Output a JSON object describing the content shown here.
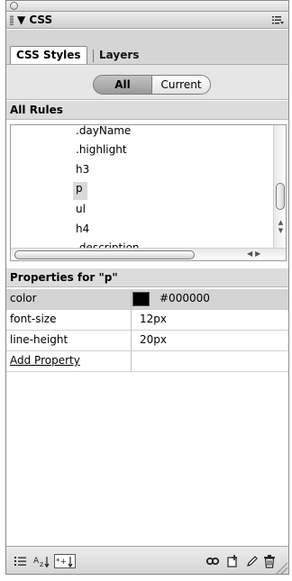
{
  "panel": {
    "group_title": "▼ CSS",
    "tabs": [
      {
        "label": "CSS Styles",
        "active": true
      },
      {
        "label": "Layers",
        "active": false
      }
    ],
    "mode_toggle": {
      "options": [
        "All",
        "Current"
      ],
      "selected": "All"
    },
    "rules_header": "All Rules",
    "rules": [
      ".dayName",
      ".highlight",
      "h3",
      "p",
      "ul",
      "h4",
      ".description"
    ],
    "selected_rule": "p",
    "properties_header": "Properties for \"p\"",
    "properties": [
      {
        "name": "color",
        "value": "#000000",
        "swatch": "#000000"
      },
      {
        "name": "font-size",
        "value": "12px"
      },
      {
        "name": "line-height",
        "value": "20px"
      }
    ],
    "add_property": "Add Property",
    "toolbar_left": [
      "show-category-view-icon",
      "show-list-view-icon",
      "show-set-properties-icon"
    ],
    "toolbar_right": [
      "attach-style-sheet-icon",
      "new-css-rule-icon",
      "edit-style-icon",
      "delete-css-rule-icon"
    ]
  }
}
